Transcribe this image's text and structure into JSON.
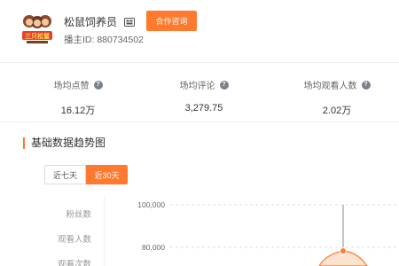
{
  "profile": {
    "name": "松鼠饲养员",
    "streamer_id": "播主ID: 880734502",
    "consult_button": "合作咨询"
  },
  "stats": [
    {
      "label": "场均点赞",
      "value": "16.12万"
    },
    {
      "label": "场均评论",
      "value": "3,279.75"
    },
    {
      "label": "场均观看人数",
      "value": "2.02万"
    }
  ],
  "section": {
    "title": "基础数据趋势图"
  },
  "tabs": [
    {
      "label": "近七天",
      "active": false
    },
    {
      "label": "近30天",
      "active": true
    }
  ],
  "metrics": [
    "粉丝数",
    "观看人数",
    "观看次数"
  ],
  "chart_data": {
    "type": "area",
    "y_ticks": [
      "100,000",
      "80,000"
    ],
    "accent": "#ff7a2e"
  },
  "colors": {
    "accent": "#ff7a2e"
  }
}
